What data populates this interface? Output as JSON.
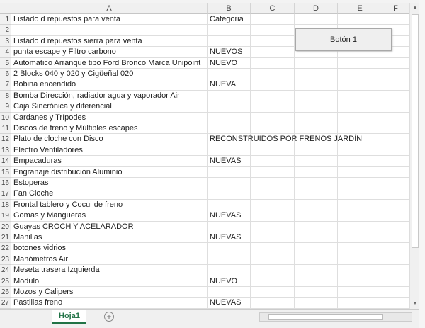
{
  "columns": [
    "A",
    "B",
    "C",
    "D",
    "E",
    "F"
  ],
  "rows": [
    {
      "n": "1",
      "a": "Listado d repuestos para venta",
      "b": "Categoria"
    },
    {
      "n": "2",
      "a": "",
      "b": ""
    },
    {
      "n": "3",
      "a": "Listado d repuestos sierra para venta",
      "b": ""
    },
    {
      "n": "4",
      "a": "punta escape y Filtro carbono",
      "b": "NUEVOS"
    },
    {
      "n": "5",
      "a": "Automático Arranque tipo Ford Bronco Marca Unipoint",
      "b": "NUEVO"
    },
    {
      "n": "6",
      "a": "2 Blocks 040 y 020 y Cigüeñal 020",
      "b": ""
    },
    {
      "n": "7",
      "a": "Bobina encendido",
      "b": "NUEVA"
    },
    {
      "n": "8",
      "a": "Bomba Dirección, radiador agua y vaporador Air",
      "b": ""
    },
    {
      "n": "9",
      "a": "Caja Sincrónica y diferencial",
      "b": ""
    },
    {
      "n": "10",
      "a": "Cardanes y Trípodes",
      "b": ""
    },
    {
      "n": "11",
      "a": "Discos de freno y Múltiples escapes",
      "b": ""
    },
    {
      "n": "12",
      "a": "Plato de cloche con Disco",
      "b": "RECONSTRUIDOS POR FRENOS JARDÍN"
    },
    {
      "n": "13",
      "a": "Electro Ventiladores",
      "b": ""
    },
    {
      "n": "14",
      "a": "Empacaduras",
      "b": "NUEVAS"
    },
    {
      "n": "15",
      "a": "Engranaje distribución Aluminio",
      "b": ""
    },
    {
      "n": "16",
      "a": "Estoperas",
      "b": ""
    },
    {
      "n": "17",
      "a": "Fan Cloche",
      "b": ""
    },
    {
      "n": "18",
      "a": "Frontal tablero y Cocui de freno",
      "b": ""
    },
    {
      "n": "19",
      "a": "Gomas y Mangueras",
      "b": "NUEVAS"
    },
    {
      "n": "20",
      "a": "Guayas CROCH Y ACELARADOR",
      "b": ""
    },
    {
      "n": "21",
      "a": "Manillas",
      "b": "NUEVAS"
    },
    {
      "n": "22",
      "a": "botones vidrios",
      "b": ""
    },
    {
      "n": "23",
      "a": "Manómetros Air",
      "b": ""
    },
    {
      "n": "24",
      "a": "Meseta trasera Izquierda",
      "b": ""
    },
    {
      "n": "25",
      "a": "Modulo",
      "b": "NUEVO"
    },
    {
      "n": "26",
      "a": "Mozos y Calipers",
      "b": ""
    },
    {
      "n": "27",
      "a": "Pastillas freno",
      "b": "NUEVAS"
    }
  ],
  "button_label": "Botón 1",
  "sheet_tab": "Hoja1",
  "add_sheet": "+"
}
